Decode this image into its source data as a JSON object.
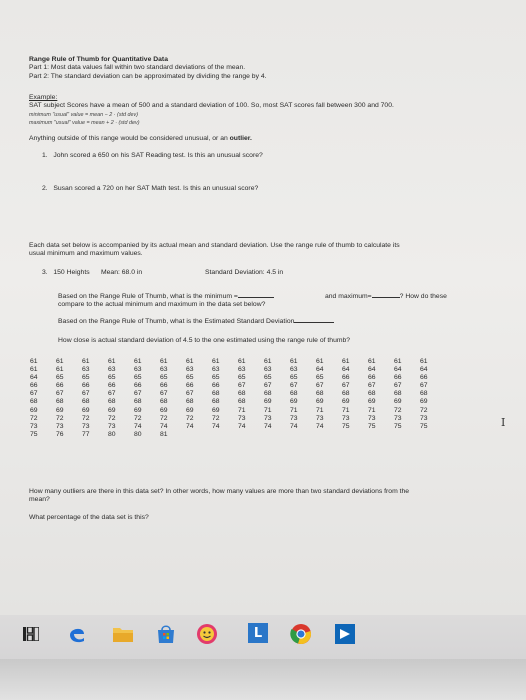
{
  "title": "Range Rule of Thumb for Quantitative Data",
  "part1": "Part 1: Most data values fall within two standard deviations of the mean.",
  "part2": "Part 2: The standard deviation can be approximated by dividing the range by 4.",
  "example_label": "Example:",
  "example_text": "SAT subject Scores have a mean of 500 and a standard deviation of 100. So, most SAT scores fall between 300 and 700.",
  "formula_min": "minimum \"usual\" value = mean − 2 · (std dev)",
  "formula_max": "maximum \"usual\" value = mean + 2 · (std dev)",
  "unusual_note_prefix": "Anything outside of this range would be considered unusual, or an ",
  "unusual_note_bold": "outlier.",
  "q1_num": "1.",
  "q1_text": "John scored a 650 on his SAT Reading test. Is this an unusual score?",
  "q2_num": "2.",
  "q2_text": "Susan scored a 720 on her SAT Math test. Is this an unusual score?",
  "each_text_l1": "Each data set below is accompanied by its actual mean and standard deviation. Use the range rule of thumb to calculate its",
  "each_text_l2": "usual minimum and maximum values.",
  "q3_num": "3.",
  "q3_title": "150 Heights",
  "q3_mean": "Mean: 68.0 in",
  "q3_sd": "Standard Deviation: 4.5 in",
  "q3a_l1": "Based on the Range Rule of Thumb, what is the minimum =",
  "q3a_l2": "compare to the actual minimum and maximum in the data set below?",
  "q3a_and_max": "and maximum=",
  "q3a_how": "? How do these",
  "q3b": "Based on the Range Rule of Thumb, what is the Estimated Standard Deviation",
  "q3c": "How close is actual standard deviation of 4.5 to the one estimated using the range rule of thumb?",
  "data_rows": [
    [
      "61",
      "61",
      "61",
      "61",
      "61",
      "61",
      "61",
      "61",
      "61",
      "61",
      "61",
      "61",
      "61",
      "61",
      "61",
      "61"
    ],
    [
      "61",
      "61",
      "63",
      "63",
      "63",
      "63",
      "63",
      "63",
      "63",
      "63",
      "63",
      "64",
      "64",
      "64",
      "64",
      "64"
    ],
    [
      "64",
      "65",
      "65",
      "65",
      "65",
      "65",
      "65",
      "65",
      "65",
      "65",
      "65",
      "65",
      "66",
      "66",
      "66",
      "66"
    ],
    [
      "66",
      "66",
      "66",
      "66",
      "66",
      "66",
      "66",
      "66",
      "67",
      "67",
      "67",
      "67",
      "67",
      "67",
      "67",
      "67"
    ],
    [
      "67",
      "67",
      "67",
      "67",
      "67",
      "67",
      "67",
      "68",
      "68",
      "68",
      "68",
      "68",
      "68",
      "68",
      "68",
      "68"
    ],
    [
      "68",
      "68",
      "68",
      "68",
      "68",
      "68",
      "68",
      "68",
      "68",
      "69",
      "69",
      "69",
      "69",
      "69",
      "69",
      "69"
    ],
    [
      "69",
      "69",
      "69",
      "69",
      "69",
      "69",
      "69",
      "69",
      "71",
      "71",
      "71",
      "71",
      "71",
      "71",
      "72",
      "72"
    ],
    [
      "72",
      "72",
      "72",
      "72",
      "72",
      "72",
      "72",
      "72",
      "73",
      "73",
      "73",
      "73",
      "73",
      "73",
      "73",
      "73"
    ],
    [
      "73",
      "73",
      "73",
      "73",
      "74",
      "74",
      "74",
      "74",
      "74",
      "74",
      "74",
      "74",
      "75",
      "75",
      "75",
      "75"
    ],
    [
      "75",
      "76",
      "77",
      "80",
      "80",
      "81"
    ]
  ],
  "outliers_q_l1": "How many outliers are there in this data set? In other words, how many values are more than two standard deviations from the",
  "outliers_q_l2": "mean?",
  "percentage_q": "What percentage of the data set is this?",
  "cursor_glyph": "I",
  "taskbar": {
    "icons": [
      "task-view-icon",
      "edge-icon",
      "file-explorer-icon",
      "store-icon",
      "emoji-app-icon",
      "launcher-icon",
      "chrome-icon",
      "flag-app-icon"
    ]
  },
  "colors": {
    "edge": "#1f6fd6",
    "explorer": "#f2c24a",
    "store": "#2f7bd0",
    "emoji": "#e23b6b",
    "launcher": "#2a76c8",
    "chrome_red": "#d9382d",
    "chrome_yellow": "#f4c020",
    "chrome_green": "#2f9b45",
    "flag": "#0e66b7"
  }
}
